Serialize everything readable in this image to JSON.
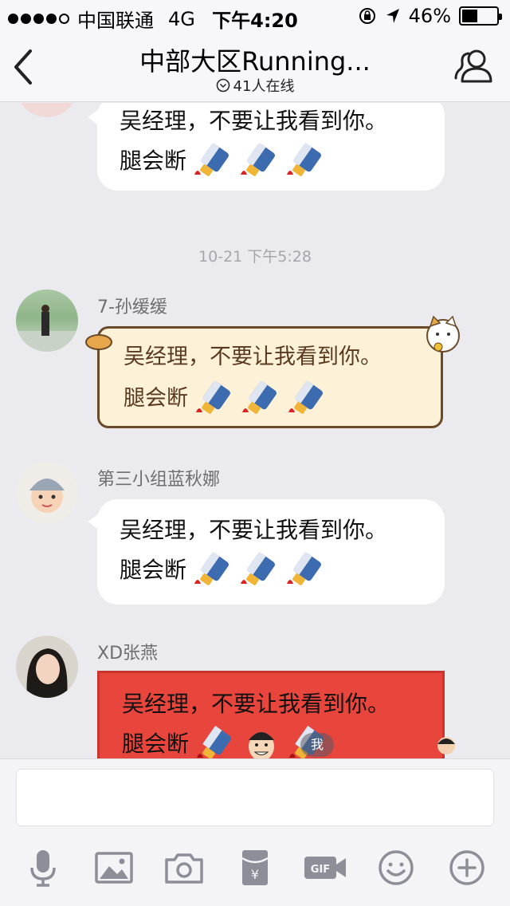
{
  "status_bar": {
    "carrier": "中国联通",
    "network": "4G",
    "time": "下午4:20",
    "battery": "46%",
    "battery_level": 0.46
  },
  "nav": {
    "title": "中部大区Running...",
    "online": "41人在线"
  },
  "messages": {
    "m1": {
      "line1": "吴经理，不要让我看到你。",
      "line2": "腿会断"
    },
    "timestamp": "10-21 下午5:28",
    "m2": {
      "sender": "7-孙缓缓",
      "line1": "吴经理，不要让我看到你。",
      "line2": "腿会断"
    },
    "m3": {
      "sender": "第三小组蓝秋娜",
      "line1": "吴经理，不要让我看到你。",
      "line2": "腿会断"
    },
    "m4": {
      "sender": "XD张燕",
      "line1": "吴经理，不要让我看到你。",
      "line2": "腿会断",
      "badge": "我"
    }
  },
  "input": {
    "placeholder": "",
    "value": ""
  },
  "toolbar": {
    "icons": [
      "microphone-icon",
      "image-icon",
      "camera-icon",
      "red-packet-icon",
      "gif-icon",
      "emoji-icon",
      "plus-icon"
    ]
  },
  "colors": {
    "background": "#eaeaef",
    "bubble": "#ffffff",
    "cat_bubble": "#fdf1d8",
    "red_bubble": "#e8453c",
    "icon": "#8e8e98"
  }
}
